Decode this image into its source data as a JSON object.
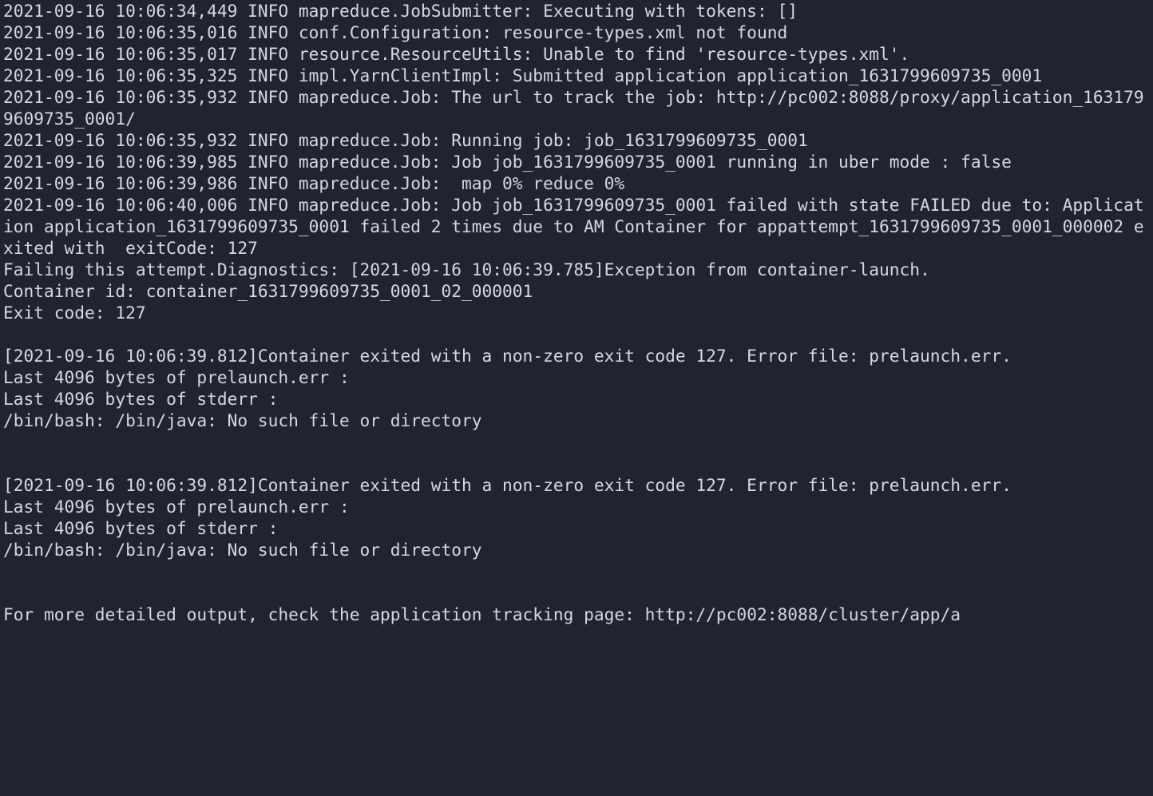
{
  "terminal": {
    "background": "#1f2430",
    "foreground": "#d4d9e0",
    "lines": [
      "2021-09-16 10:06:34,449 INFO mapreduce.JobSubmitter: Executing with tokens: []",
      "2021-09-16 10:06:35,016 INFO conf.Configuration: resource-types.xml not found",
      "2021-09-16 10:06:35,017 INFO resource.ResourceUtils: Unable to find 'resource-types.xml'.",
      "2021-09-16 10:06:35,325 INFO impl.YarnClientImpl: Submitted application application_1631799609735_0001",
      "2021-09-16 10:06:35,932 INFO mapreduce.Job: The url to track the job: http://pc002:8088/proxy/application_1631799609735_0001/",
      "2021-09-16 10:06:35,932 INFO mapreduce.Job: Running job: job_1631799609735_0001",
      "2021-09-16 10:06:39,985 INFO mapreduce.Job: Job job_1631799609735_0001 running in uber mode : false",
      "2021-09-16 10:06:39,986 INFO mapreduce.Job:  map 0% reduce 0%",
      "2021-09-16 10:06:40,006 INFO mapreduce.Job: Job job_1631799609735_0001 failed with state FAILED due to: Application application_1631799609735_0001 failed 2 times due to AM Container for appattempt_1631799609735_0001_000002 exited with  exitCode: 127",
      "Failing this attempt.Diagnostics: [2021-09-16 10:06:39.785]Exception from container-launch.",
      "Container id: container_1631799609735_0001_02_000001",
      "Exit code: 127",
      "",
      "[2021-09-16 10:06:39.812]Container exited with a non-zero exit code 127. Error file: prelaunch.err.",
      "Last 4096 bytes of prelaunch.err :",
      "Last 4096 bytes of stderr :",
      "/bin/bash: /bin/java: No such file or directory",
      "",
      "",
      "[2021-09-16 10:06:39.812]Container exited with a non-zero exit code 127. Error file: prelaunch.err.",
      "Last 4096 bytes of prelaunch.err :",
      "Last 4096 bytes of stderr :",
      "/bin/bash: /bin/java: No such file or directory",
      "",
      "",
      "For more detailed output, check the application tracking page: http://pc002:8088/cluster/app/a"
    ]
  }
}
